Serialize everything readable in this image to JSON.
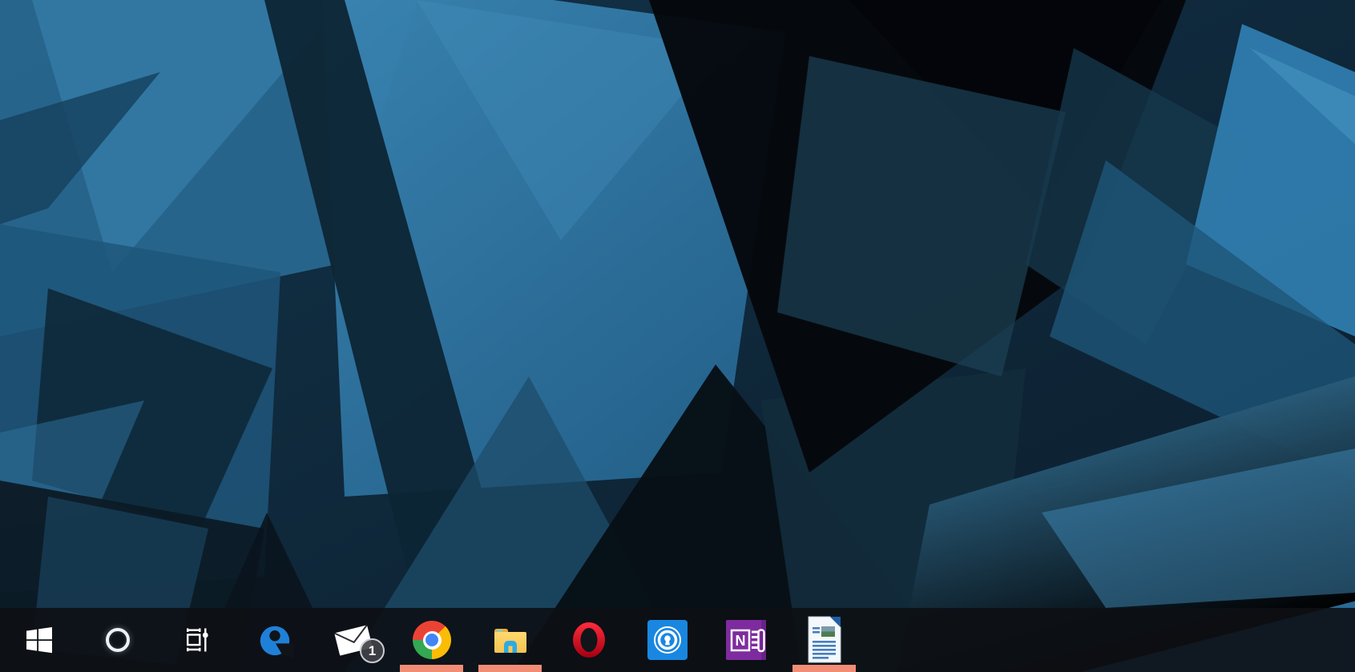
{
  "taskbar": {
    "items": [
      {
        "id": "start",
        "icon": "windows-start-icon",
        "active": false
      },
      {
        "id": "cortana",
        "icon": "cortana-circle-icon",
        "active": false
      },
      {
        "id": "task-view",
        "icon": "task-view-icon",
        "active": false
      },
      {
        "id": "edge",
        "icon": "edge-icon",
        "active": false
      },
      {
        "id": "mail",
        "icon": "mail-icon",
        "active": false,
        "badge": "1"
      },
      {
        "id": "chrome",
        "icon": "chrome-icon",
        "active": true
      },
      {
        "id": "file-explorer",
        "icon": "file-explorer-icon",
        "active": true
      },
      {
        "id": "opera",
        "icon": "opera-icon",
        "active": false
      },
      {
        "id": "onepassword",
        "icon": "1password-icon",
        "active": false
      },
      {
        "id": "onenote",
        "icon": "onenote-icon",
        "active": false
      },
      {
        "id": "writer",
        "icon": "libreoffice-writer-icon",
        "active": true
      }
    ]
  },
  "colors": {
    "active_underline_accent": "#F18D75",
    "taskbar_background": "rgba(13,16,20,0.90)",
    "wallpaper_bright_blue": "#2F7CAE",
    "wallpaper_dark_navy": "#0D2334",
    "wallpaper_near_black": "#05080C",
    "edge_blue": "#1F80D8",
    "onepassword_blue": "#1987E0",
    "onenote_purple": "#7E2B9F"
  }
}
